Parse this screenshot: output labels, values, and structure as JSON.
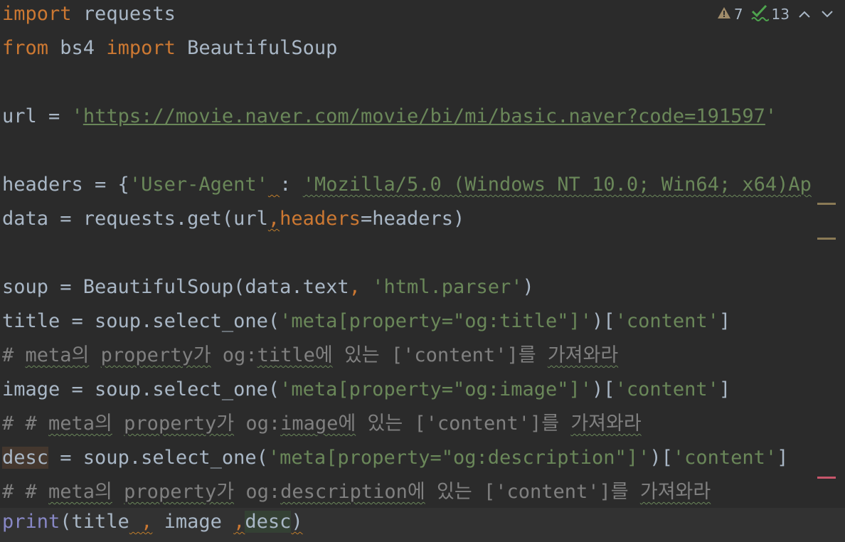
{
  "inspection": {
    "warnings_count": "7",
    "weak_warnings_count": "13",
    "warning_icon": "warning-triangle-icon",
    "weak_warning_icon": "check-squiggle-icon"
  },
  "colors": {
    "background": "#2b2b2b",
    "keyword": "#cc7832",
    "string": "#6a8759",
    "comment": "#808080",
    "identifier": "#a9b7c6",
    "builtin": "#8888c6",
    "marker_warning": "#8a7a55",
    "marker_error": "#c8566b"
  },
  "code": {
    "l1": {
      "t1": "import",
      "t2": " requests"
    },
    "l2": {
      "t1": "from",
      "t2": " bs4 ",
      "t3": "import",
      "t4": " BeautifulSoup"
    },
    "l4": {
      "t1": "url = ",
      "t2": "'",
      "t3": "https://movie.naver.com/movie/bi/mi/basic.naver?code=191597",
      "t4": "'"
    },
    "l6": {
      "t1": "headers = {",
      "t2": "'User-Agent'",
      "t3": " ",
      "t4": ":",
      "t5": " ",
      "t6": "'Mozilla/5.0 (Windows NT 10.0; Win64; x64)Ap"
    },
    "l7": {
      "t1": "data = requests.get(url",
      "t2": ",",
      "t3": "headers",
      "t4": "=headers)"
    },
    "l9": {
      "t1": "soup = BeautifulSoup(data.text",
      "t2": ", ",
      "t3": "'html.parser'",
      "t4": ")"
    },
    "l10": {
      "t1": "title = soup.select_one(",
      "t2": "'meta[property=\"og:title\"]'",
      "t3": ")[",
      "t4": "'content'",
      "t5": "]"
    },
    "l11": {
      "t1": "# ",
      "t2": "meta의",
      "t3": " ",
      "t4": "property가",
      "t5": " og:",
      "t6": "title에",
      "t7": " 있는 ['content']를 ",
      "t8": "가져와라"
    },
    "l12": {
      "t1": "image = soup.select_one(",
      "t2": "'meta[property=\"og:image\"]'",
      "t3": ")[",
      "t4": "'content'",
      "t5": "]"
    },
    "l13": {
      "t1": "# # ",
      "t2": "meta의",
      "t3": " ",
      "t4": "property가",
      "t5": " og:",
      "t6": "image에",
      "t7": " 있는 ['content']를 ",
      "t8": "가져와라"
    },
    "l14": {
      "t1": "desc",
      "t2": " = soup.select_one(",
      "t3": "'meta[property=\"og:description\"]'",
      "t4": ")[",
      "t5": "'content'",
      "t6": "]"
    },
    "l15": {
      "t1": "# # ",
      "t2": "meta의",
      "t3": " ",
      "t4": "property가",
      "t5": " og:",
      "t6": "description에",
      "t7": " 있는 ['content']를 ",
      "t8": "가져와라"
    },
    "l16": {
      "t1": "print",
      "t2": "(title",
      "t3": " ,",
      "t4": " image ",
      "t5": ",",
      "t6": "desc",
      "t7": ")"
    }
  }
}
